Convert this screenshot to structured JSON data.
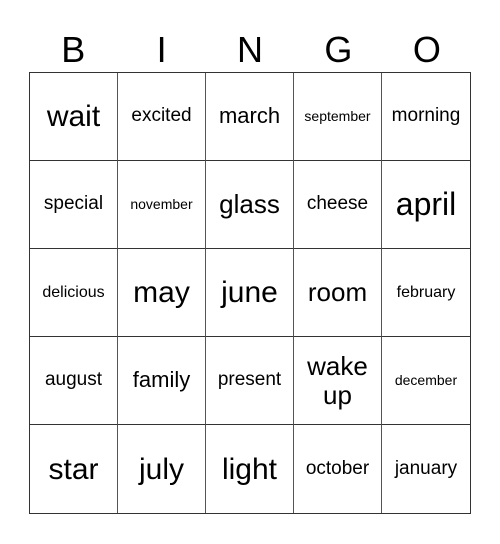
{
  "header": [
    "B",
    "I",
    "N",
    "G",
    "O"
  ],
  "cells": [
    "wait",
    "excited",
    "march",
    "september",
    "morning",
    "special",
    "november",
    "glass",
    "cheese",
    "april",
    "delicious",
    "may",
    "june",
    "room",
    "february",
    "august",
    "family",
    "present",
    "wake up",
    "december",
    "star",
    "july",
    "light",
    "october",
    "january"
  ]
}
